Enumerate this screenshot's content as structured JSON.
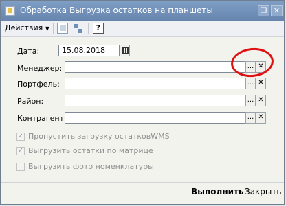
{
  "window": {
    "title": "Обработка  Выгрузка остатков на планшеты"
  },
  "titlebar_buttons": {
    "restore": "❐",
    "close": "✕"
  },
  "toolbar": {
    "actions_label": "Действия",
    "help_label": "?"
  },
  "form": {
    "date_label": "Дата:",
    "date_value": "15.08.2018",
    "manager_label": "Менеджер:",
    "manager_value": "",
    "portfolio_label": "Портфель:",
    "portfolio_value": "",
    "district_label": "Район:",
    "district_value": "",
    "counterparty_label": "Контрагент:",
    "counterparty_value": "",
    "select_glyph": "...",
    "clear_glyph": "✕"
  },
  "options": [
    {
      "label": "Пропустить загрузку остатковWMS",
      "checked": true
    },
    {
      "label": "Выгрузить остатки по матрице",
      "checked": true
    },
    {
      "label": "Выгрузить фото номенклатуры",
      "checked": false
    }
  ],
  "footer": {
    "run_label": "Выполнить",
    "close_label": "Закрыть"
  },
  "colors": {
    "titlebar": "#6684ad",
    "annotation": "#e01010"
  }
}
